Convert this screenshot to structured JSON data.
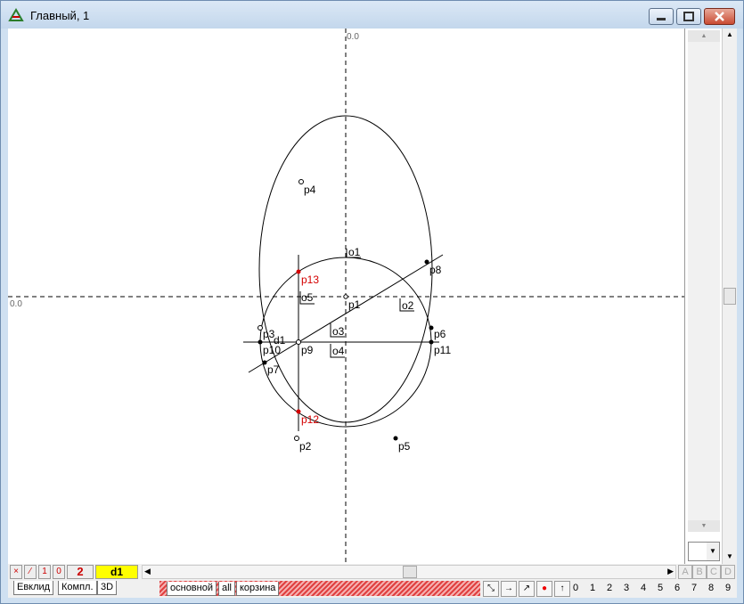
{
  "window": {
    "title": "Главный, 1"
  },
  "canvas": {
    "axis_top_label": "0.0",
    "axis_left_label": "0.0",
    "points": [
      {
        "name": "p1",
        "color": "black"
      },
      {
        "name": "p2",
        "color": "black"
      },
      {
        "name": "p3",
        "color": "black"
      },
      {
        "name": "p4",
        "color": "black"
      },
      {
        "name": "p5",
        "color": "black"
      },
      {
        "name": "p6",
        "color": "black"
      },
      {
        "name": "p7",
        "color": "black"
      },
      {
        "name": "p8",
        "color": "black"
      },
      {
        "name": "p9",
        "color": "black"
      },
      {
        "name": "p10",
        "color": "black"
      },
      {
        "name": "p11",
        "color": "black"
      },
      {
        "name": "p12",
        "color": "#d40000"
      },
      {
        "name": "p13",
        "color": "#d40000"
      }
    ],
    "markers": [
      "o1",
      "o2",
      "o3",
      "o4",
      "o5",
      "d1"
    ]
  },
  "toolbar": {
    "buttons": [
      "×",
      "⁄",
      "1",
      "0"
    ],
    "count": "2",
    "active_layer": "d1",
    "letters": [
      "A",
      "B",
      "C",
      "D"
    ]
  },
  "tabs": {
    "left": [
      "Евклид",
      "Компл.",
      "3D"
    ],
    "middle": [
      "основной",
      "all",
      "корзина"
    ]
  },
  "digits": [
    "0",
    "1",
    "2",
    "3",
    "4",
    "5",
    "6",
    "7",
    "8",
    "9"
  ]
}
